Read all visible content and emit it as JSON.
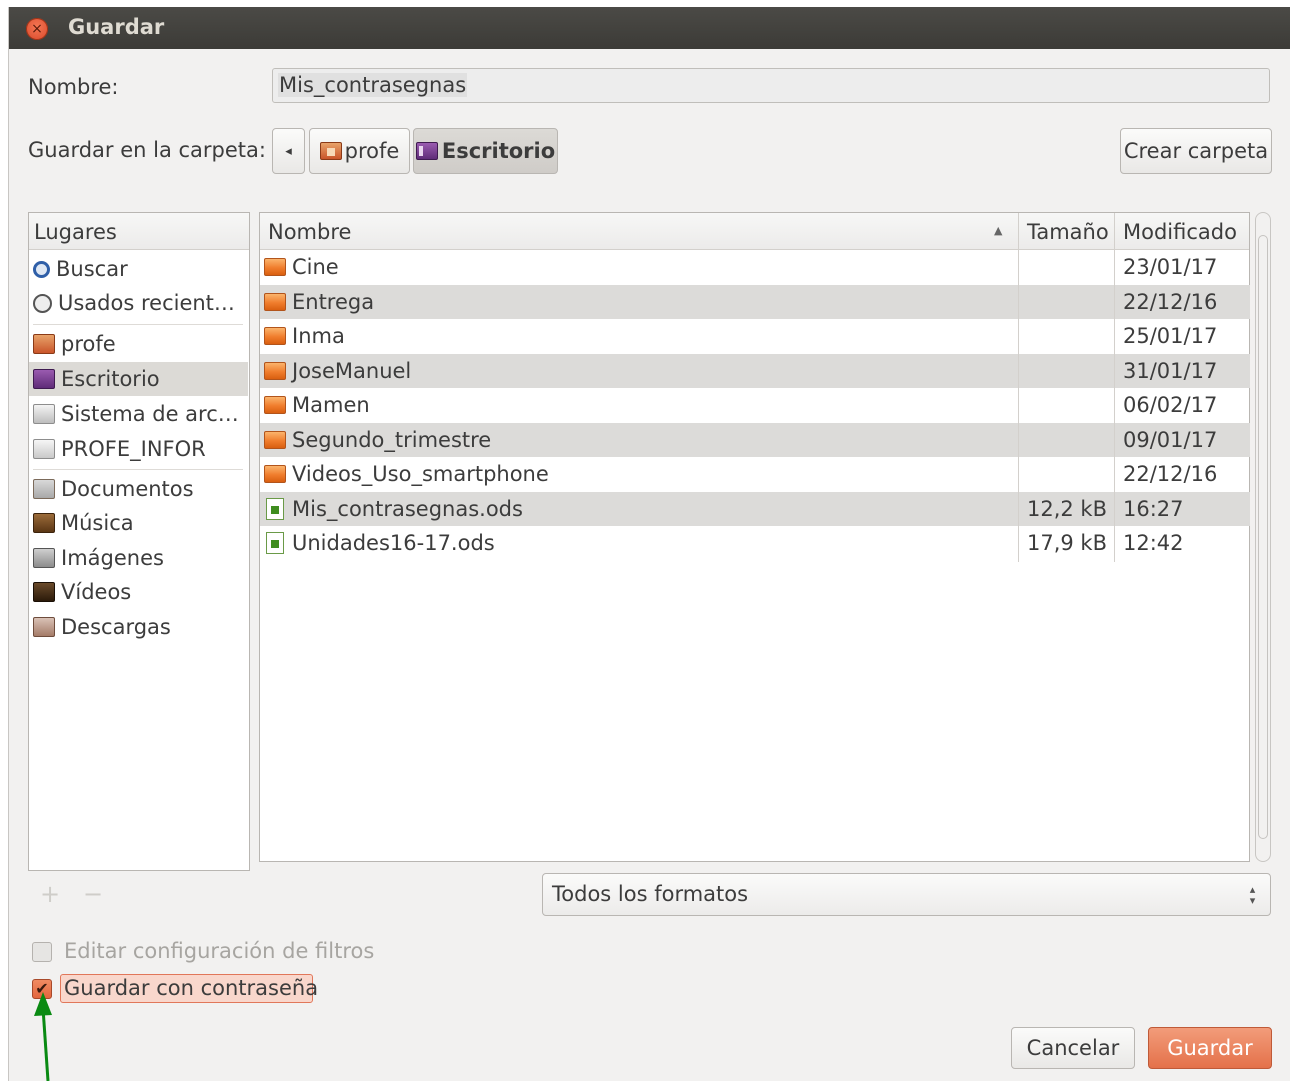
{
  "window": {
    "title": "Guardar"
  },
  "name_row": {
    "label": "Nombre:",
    "value": "Mis_contrasegnas"
  },
  "folder_row": {
    "label": "Guardar en la carpeta:",
    "back_glyph": "◂",
    "path": [
      "profe",
      "Escritorio"
    ],
    "create_folder": "Crear carpeta"
  },
  "places": {
    "header": "Lugares",
    "items": [
      {
        "label": "Buscar",
        "icon": "search-icon"
      },
      {
        "label": "Usados recient…",
        "icon": "recent-icon"
      },
      {
        "label": "profe",
        "icon": "home-folder-icon"
      },
      {
        "label": "Escritorio",
        "icon": "desktop-folder-icon",
        "selected": true
      },
      {
        "label": "Sistema de arc…",
        "icon": "drive-icon"
      },
      {
        "label": "PROFE_INFOR",
        "icon": "usb-drive-icon"
      },
      {
        "label": "Documentos",
        "icon": "documents-icon"
      },
      {
        "label": "Música",
        "icon": "music-icon"
      },
      {
        "label": "Imágenes",
        "icon": "pictures-icon"
      },
      {
        "label": "Vídeos",
        "icon": "videos-icon"
      },
      {
        "label": "Descargas",
        "icon": "downloads-icon"
      }
    ],
    "add_glyph": "+",
    "remove_glyph": "−"
  },
  "files": {
    "columns": {
      "name": "Nombre",
      "size": "Tamaño",
      "modified": "Modificado"
    },
    "sort_glyph": "▲",
    "rows": [
      {
        "name": "Cine",
        "size": "",
        "modified": "23/01/17",
        "type": "folder"
      },
      {
        "name": "Entrega",
        "size": "",
        "modified": "22/12/16",
        "type": "folder"
      },
      {
        "name": "Inma",
        "size": "",
        "modified": "25/01/17",
        "type": "folder"
      },
      {
        "name": "JoseManuel",
        "size": "",
        "modified": "31/01/17",
        "type": "folder"
      },
      {
        "name": "Mamen",
        "size": "",
        "modified": "06/02/17",
        "type": "folder"
      },
      {
        "name": "Segundo_trimestre",
        "size": "",
        "modified": "09/01/17",
        "type": "folder"
      },
      {
        "name": "Videos_Uso_smartphone",
        "size": "",
        "modified": "22/12/16",
        "type": "folder"
      },
      {
        "name": "Mis_contrasegnas.ods",
        "size": "12,2 kB",
        "modified": "16:27",
        "type": "spreadsheet"
      },
      {
        "name": "Unidades16-17.ods",
        "size": "17,9 kB",
        "modified": "12:42",
        "type": "spreadsheet"
      }
    ]
  },
  "filter": {
    "value": "Todos los formatos",
    "arrows": "▴▾"
  },
  "options": {
    "edit_filter": {
      "label": "Editar configuración de filtros",
      "checked": false,
      "enabled": false
    },
    "save_password": {
      "label": "Guardar con contraseña",
      "checked": true,
      "check_glyph": "✔"
    }
  },
  "buttons": {
    "cancel": "Cancelar",
    "save": "Guardar"
  },
  "colors": {
    "accent": "#e9734d",
    "titlebar": "#3c3b37",
    "annotation_arrow": "#0a8a12"
  }
}
